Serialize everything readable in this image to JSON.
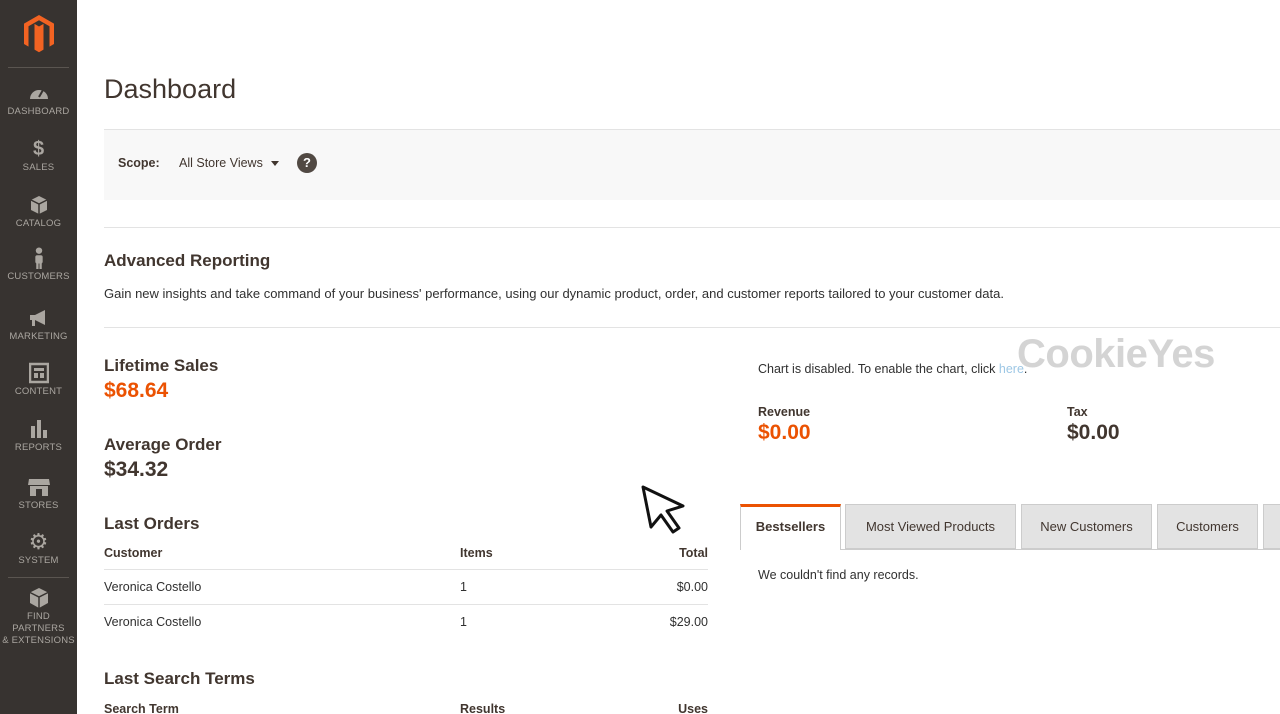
{
  "sidebar": {
    "items": [
      {
        "label": "DASHBOARD",
        "icon": "dashboard-icon"
      },
      {
        "label": "SALES",
        "icon": "dollar-icon"
      },
      {
        "label": "CATALOG",
        "icon": "box-icon"
      },
      {
        "label": "CUSTOMERS",
        "icon": "person-icon"
      },
      {
        "label": "MARKETING",
        "icon": "megaphone-icon"
      },
      {
        "label": "CONTENT",
        "icon": "layout-icon"
      },
      {
        "label": "REPORTS",
        "icon": "bar-chart-icon"
      },
      {
        "label": "STORES",
        "icon": "store-icon"
      },
      {
        "label": "SYSTEM",
        "icon": "gear-icon"
      },
      {
        "label": "FIND PARTNERS",
        "label2": "& EXTENSIONS",
        "icon": "cubes-icon"
      }
    ]
  },
  "page": {
    "title": "Dashboard"
  },
  "scope": {
    "label": "Scope:",
    "value": "All Store Views",
    "help": "?"
  },
  "advanced": {
    "title": "Advanced Reporting",
    "text": "Gain new insights and take command of your business' performance, using our dynamic product, order, and customer reports tailored to your customer data."
  },
  "metrics": {
    "lifetime_label": "Lifetime Sales",
    "lifetime_value": "$68.64",
    "average_label": "Average Order",
    "average_value": "$34.32"
  },
  "last_orders": {
    "title": "Last Orders",
    "headers": [
      "Customer",
      "Items",
      "Total"
    ],
    "rows": [
      [
        "Veronica Costello",
        "1",
        "$0.00"
      ],
      [
        "Veronica Costello",
        "1",
        "$29.00"
      ]
    ]
  },
  "last_search": {
    "title": "Last Search Terms",
    "headers": [
      "Search Term",
      "Results",
      "Uses"
    ]
  },
  "chart": {
    "message": "Chart is disabled. To enable the chart, click ",
    "link": "here",
    "revenue_label": "Revenue",
    "revenue_value": "$0.00",
    "tax_label": "Tax",
    "tax_value": "$0.00"
  },
  "watermark": "CookieYes",
  "tabs": [
    "Bestsellers",
    "Most Viewed Products",
    "New Customers",
    "Customers"
  ],
  "tab_panel": {
    "empty": "We couldn't find any records."
  },
  "colors": {
    "accent": "#eb5202",
    "sidebar": "#373330"
  }
}
